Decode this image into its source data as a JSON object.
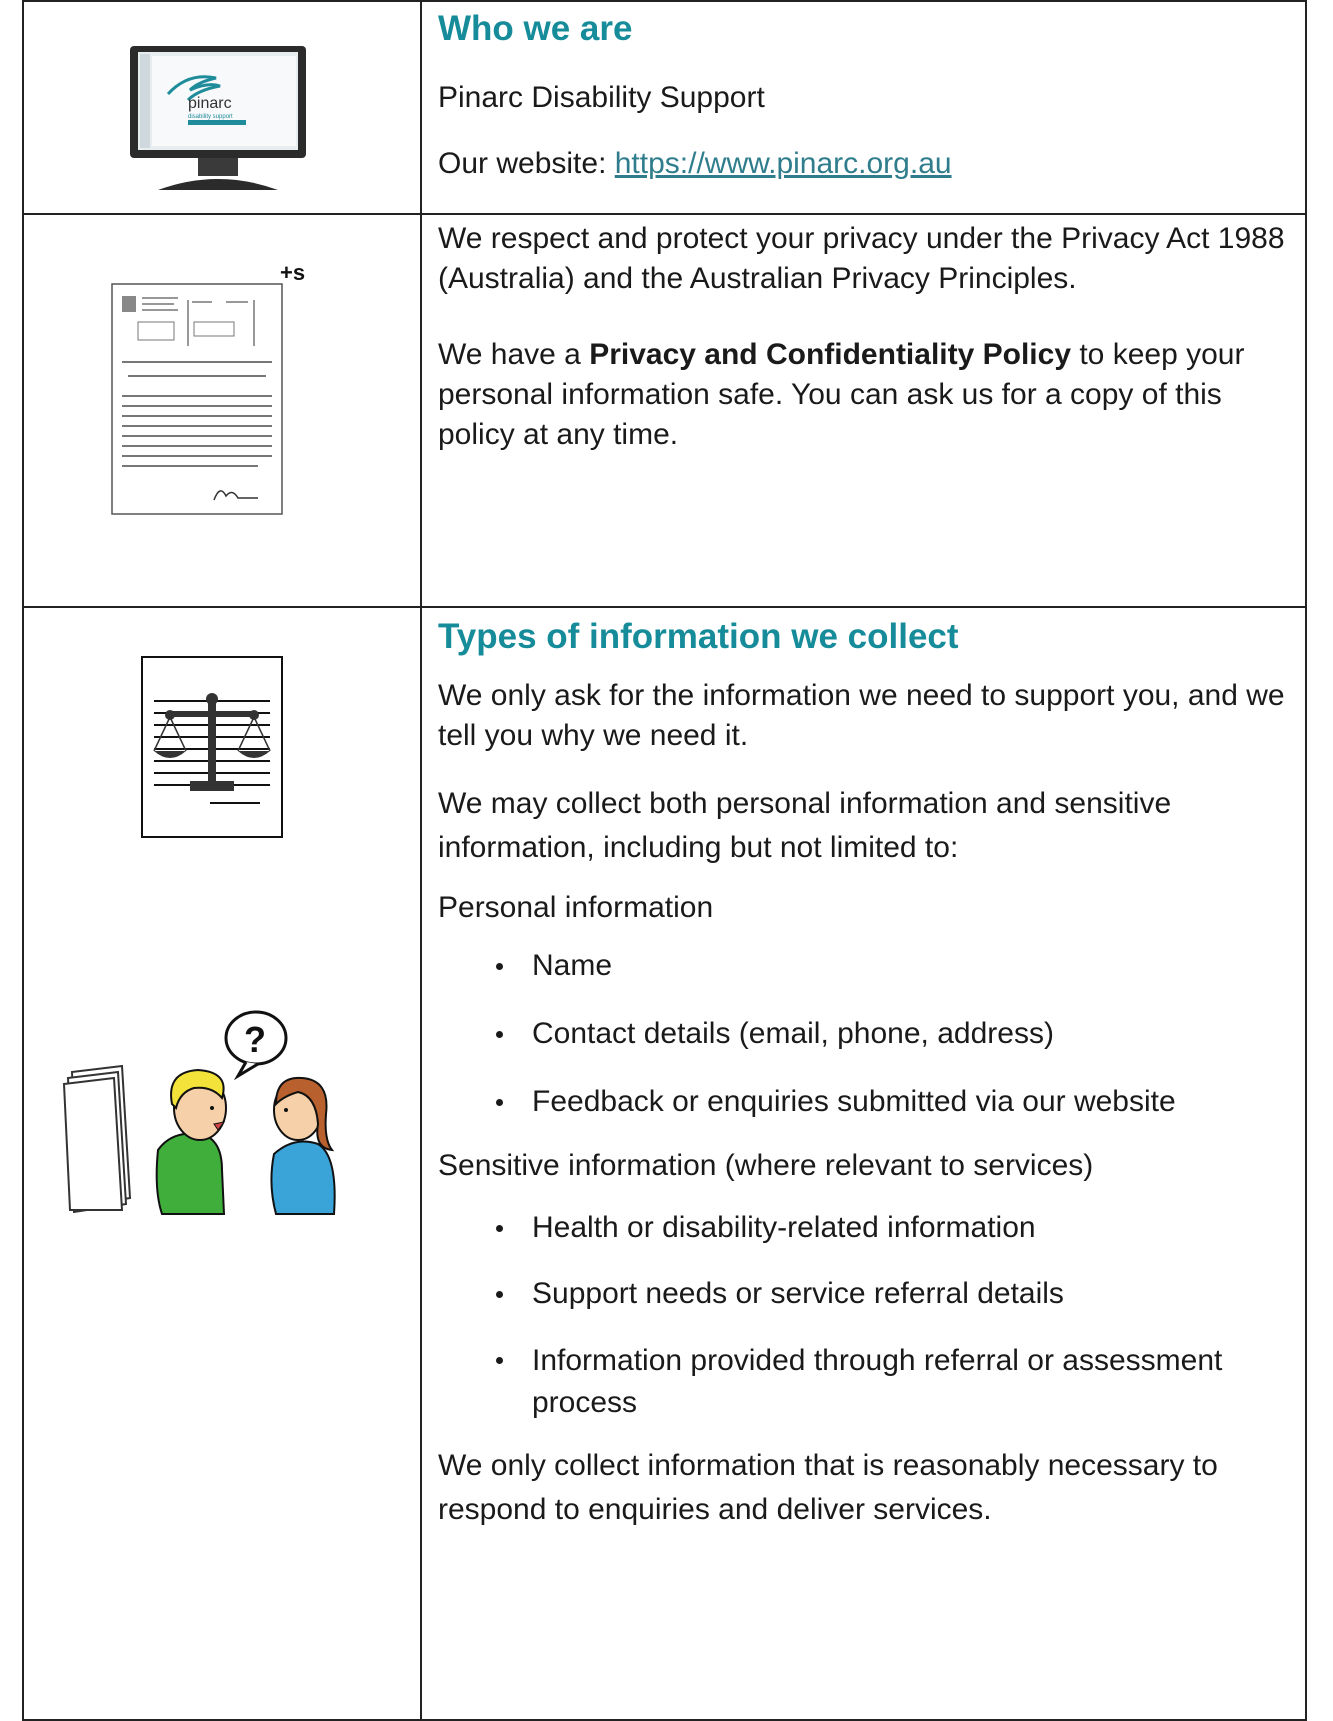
{
  "row1": {
    "heading": "Who we are",
    "org_name": "Pinarc Disability Support",
    "website_label": "Our website: ",
    "website_url": "https://www.pinarc.org.au",
    "monitor_logo_text": "pinarc",
    "monitor_logo_sub": "disability support"
  },
  "row2": {
    "para1": "We respect and protect your privacy under the Privacy Act 1988 (Australia) and the Australian Privacy Principles.",
    "para2_pre": "We have a ",
    "para2_bold": "Privacy and Confidentiality Policy",
    "para2_post": " to keep your personal information safe. You can ask us for a copy of this policy at any time.",
    "doc_icon_mark": "+s"
  },
  "row3": {
    "heading": "Types of information we collect",
    "intro1": "We only ask for the information we need to support you, and we tell you why we need it.",
    "intro2": "We may collect both personal information and sensitive information, including but not limited to:",
    "personal_title": "Personal information",
    "personal_items": [
      "Name",
      "Contact details (email, phone, address)",
      "Feedback or enquiries submitted via our website"
    ],
    "sensitive_title": "Sensitive information (where relevant to services)",
    "sensitive_items": [
      "Health or disability-related information",
      "Support needs or service referral details",
      "Information provided through referral or assessment process"
    ],
    "closing": "We only collect information that is reasonably necessary to respond to enquiries and deliver services.",
    "speech_mark": "?"
  },
  "colors": {
    "heading": "#168b9a",
    "link": "#2f7d8c",
    "border": "#222222"
  }
}
